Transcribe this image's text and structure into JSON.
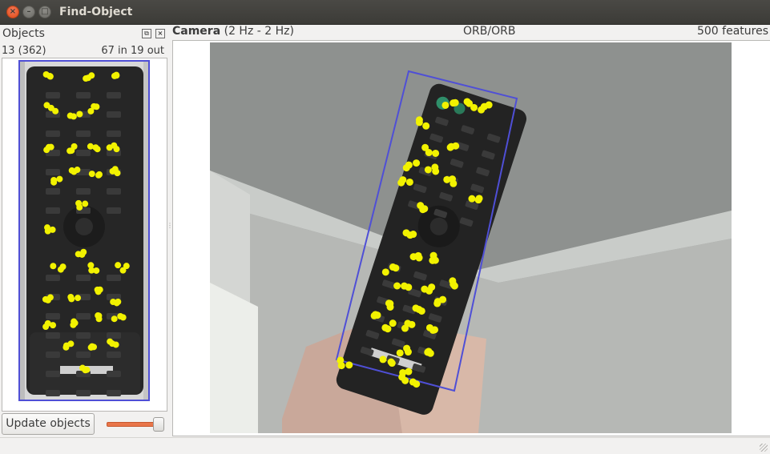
{
  "window": {
    "title": "Find-Object"
  },
  "objects_dock": {
    "title": "Objects",
    "count_label": "13 (362)",
    "inliers_label": "67 in 19 out",
    "update_button": "Update objects",
    "slider_value_fraction": 0.9
  },
  "camera": {
    "title": "Camera",
    "rate": "(2 Hz - 2 Hz)",
    "algorithm": "ORB/ORB",
    "features": "500 features"
  },
  "colors": {
    "keypoint": "#f2f200",
    "detection_box": "#4f4fd6",
    "close_button": "#df4b16"
  }
}
